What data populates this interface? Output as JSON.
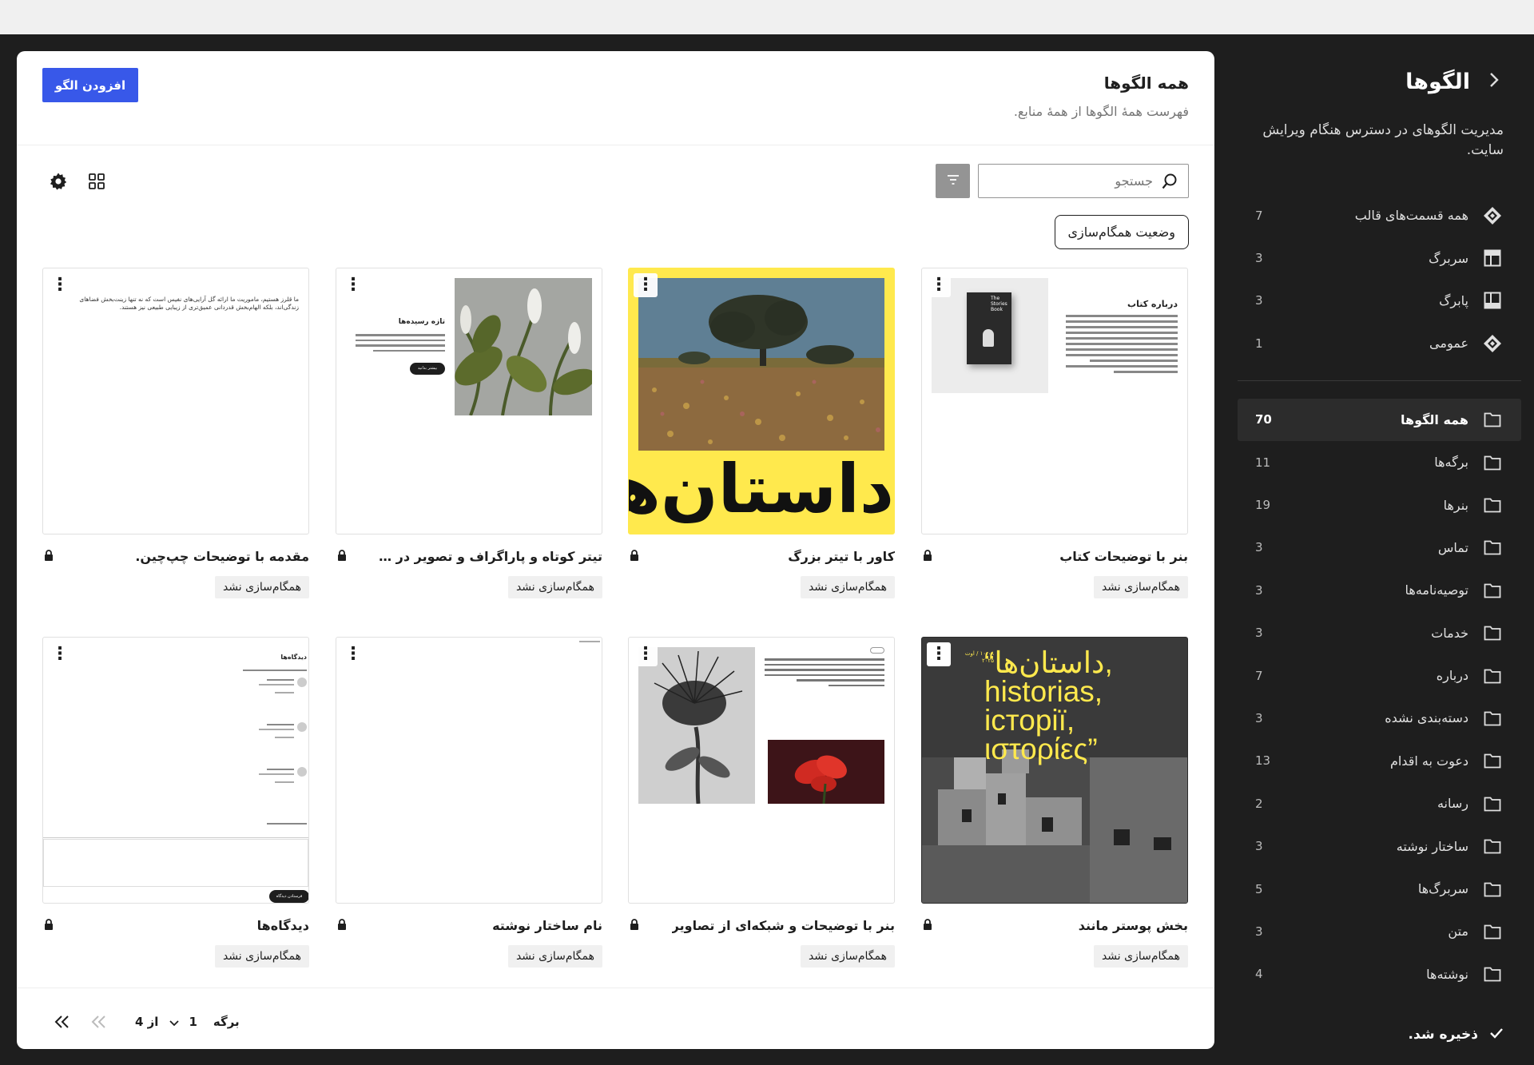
{
  "sidebar": {
    "title": "الگوها",
    "description": "مدیریت الگوهای در دسترس هنگام ویرایش سایت.",
    "template_parts": [
      {
        "label": "همه قسمت‌های قالب",
        "count": "7",
        "icon": "diamond-icon"
      },
      {
        "label": "سربرگ",
        "count": "3",
        "icon": "header-layout-icon"
      },
      {
        "label": "پابرگ",
        "count": "3",
        "icon": "footer-layout-icon"
      },
      {
        "label": "عمومی",
        "count": "1",
        "icon": "diamond-icon"
      }
    ],
    "categories": [
      {
        "label": "همه الگوها",
        "count": "70",
        "active": true
      },
      {
        "label": "برگه‌ها",
        "count": "11"
      },
      {
        "label": "بنرها",
        "count": "19"
      },
      {
        "label": "تماس",
        "count": "3"
      },
      {
        "label": "توصیه‌نامه‌ها",
        "count": "3"
      },
      {
        "label": "خدمات",
        "count": "3"
      },
      {
        "label": "درباره",
        "count": "7"
      },
      {
        "label": "دسته‌بندی نشده",
        "count": "3"
      },
      {
        "label": "دعوت به اقدام",
        "count": "13"
      },
      {
        "label": "رسانه",
        "count": "2"
      },
      {
        "label": "ساختار نوشته",
        "count": "3"
      },
      {
        "label": "سربرگ‌ها",
        "count": "5"
      },
      {
        "label": "متن",
        "count": "3"
      },
      {
        "label": "نوشته‌ها",
        "count": "4"
      }
    ],
    "footer_status": "ذخیره شد."
  },
  "main": {
    "title": "همه الگوها",
    "subtitle": "فهرست همهٔ الگوها از همهٔ منابع.",
    "add_button": "افزودن الگو",
    "search_placeholder": "جستجو",
    "sync_filter": "وضعیت همگام‌سازی",
    "sync_badge": "همگام‌سازی نشد",
    "patterns": [
      {
        "title": "بنر با توضیحات کتاب"
      },
      {
        "title": "کاور با تیتر بزرگ"
      },
      {
        "title": "تیتر کوتاه و پاراگراف و تصویر در سم..."
      },
      {
        "title": "مقدمه با توضیحات چپ‌چین."
      },
      {
        "title": "بخش پوستر مانند"
      },
      {
        "title": "بنر با توضیحات و شبکه‌ای از تصاویر"
      },
      {
        "title": "نام ساختار نوشته"
      },
      {
        "title": "دیدگاه‌ها"
      }
    ],
    "thumbs": {
      "book_title": "درباره کتاب",
      "book_cover": "The Stories Book",
      "cover_heading": "داستان‌ها",
      "news_heading": "تازه رسیده‌ها",
      "news_button": "بیشتر بدانید",
      "intro_text": "ما قلرز هستیم، ماموریت ما ارائه گل آرایی‌های نفیس است که نه تنها زینت‌بخش فضاهای زندگی‌اند، بلکه الهام‌بخش قدردانی عمیق‌تری از زیبایی طبیعی نیز هستند.",
      "poster_heading": "“داستان‌ها, historias, iсторії, ιστορίες”",
      "poster_date": "۱۰:۰۸ / اوت ۲۰۲۵",
      "comments_heading": "دیدگاه‌ها",
      "comments_button": "فرستادن دیدگاه"
    },
    "pagination": {
      "page_label": "برگه",
      "current_page": "1",
      "of_label": "از 4"
    }
  },
  "colors": {
    "accent": "#3858e9",
    "frame": "#1e1e1e",
    "cover_yellow": "#ffe94d"
  }
}
